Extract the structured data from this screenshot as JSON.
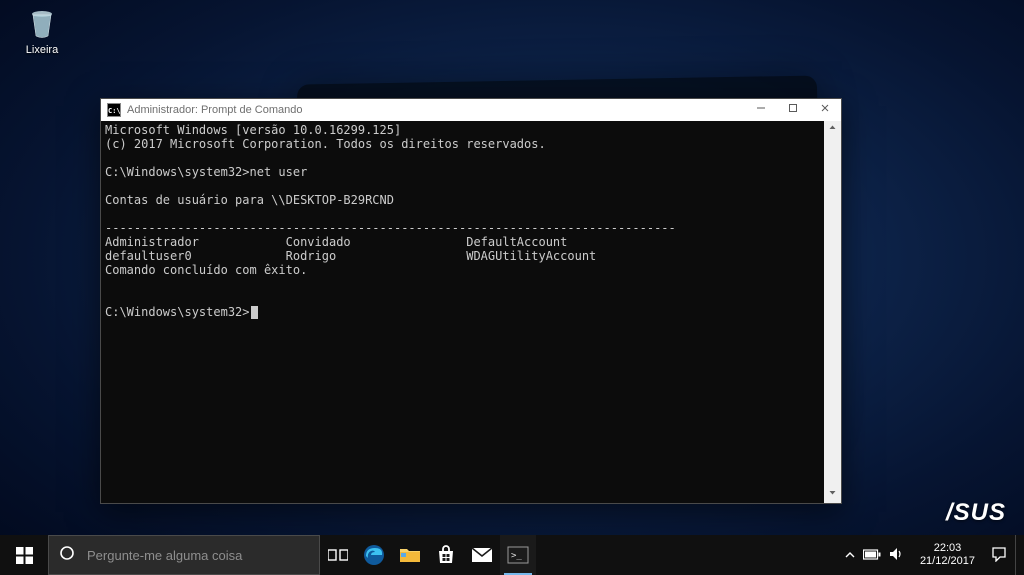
{
  "desktop": {
    "recycle_bin_label": "Lixeira",
    "brand_logo_text": "/SUS"
  },
  "cmd_window": {
    "title": "Administrador: Prompt de Comando",
    "lines": {
      "l1": "Microsoft Windows [versão 10.0.16299.125]",
      "l2": "(c) 2017 Microsoft Corporation. Todos os direitos reservados.",
      "blank1": "",
      "l3": "C:\\Windows\\system32>net user",
      "blank2": "",
      "l4": "Contas de usuário para \\\\DESKTOP-B29RCND",
      "blank3": "",
      "dashes": "-------------------------------------------------------------------------------",
      "row1": "Administrador            Convidado                DefaultAccount",
      "row2": "defaultuser0             Rodrigo                  WDAGUtilityAccount",
      "done": "Comando concluído com êxito.",
      "blank4": "",
      "blank5": "",
      "prompt": "C:\\Windows\\system32>"
    }
  },
  "taskbar": {
    "search_placeholder": "Pergunte-me alguma coisa"
  },
  "tray": {
    "time": "22:03",
    "date": "21/12/2017"
  }
}
